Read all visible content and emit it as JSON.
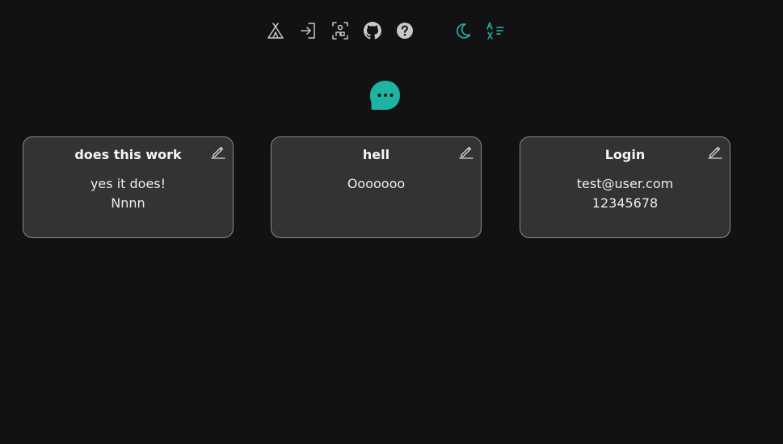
{
  "toolbar": {
    "icons": [
      {
        "name": "tent-icon",
        "color": "#c8c8c8"
      },
      {
        "name": "login-icon",
        "color": "#c8c8c8"
      },
      {
        "name": "scan-person-icon",
        "color": "#c8c8c8"
      },
      {
        "name": "github-icon",
        "color": "#c8c8c8"
      },
      {
        "name": "help-icon",
        "color": "#c8c8c8"
      },
      {
        "name": "moon-icon",
        "color": "#26b5a6"
      },
      {
        "name": "language-icon",
        "color": "#26b5a6"
      }
    ]
  },
  "chat_button": {
    "icon": "chat-bubble-icon",
    "color": "#1fb3a3"
  },
  "notes": [
    {
      "title": "does this work",
      "lines": [
        "yes it does!",
        "Nnnn"
      ]
    },
    {
      "title": "hell",
      "lines": [
        "Ooooooo"
      ]
    },
    {
      "title": "Login",
      "lines": [
        "test@user.com",
        "12345678"
      ]
    }
  ],
  "colors": {
    "background": "#121212",
    "card": "#333333",
    "card_border": "#8a8a8a",
    "accent": "#26b5a6"
  }
}
